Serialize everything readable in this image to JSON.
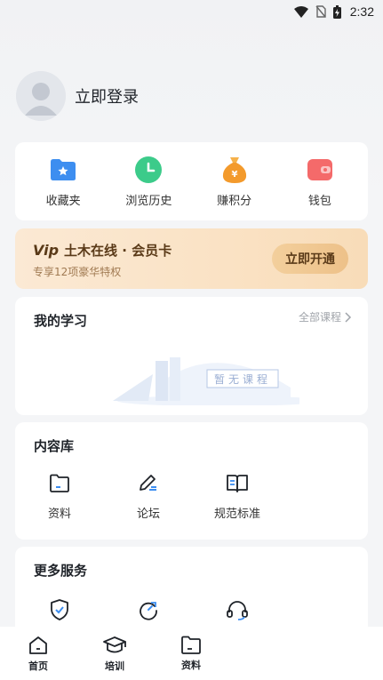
{
  "status_bar": {
    "time": "2:32"
  },
  "profile": {
    "login_label": "立即登录"
  },
  "quick_actions": [
    {
      "label": "收藏夹",
      "icon": "favorites-folder-icon",
      "color": "#3d8ef0"
    },
    {
      "label": "浏览历史",
      "icon": "clock-icon",
      "color": "#3ccb8a"
    },
    {
      "label": "赚积分",
      "icon": "money-bag-icon",
      "color": "#f39a2c"
    },
    {
      "label": "钱包",
      "icon": "wallet-icon",
      "color": "#f46a6a"
    }
  ],
  "vip": {
    "badge": "Vip",
    "title": "土木在线 · 会员卡",
    "subtitle": "专享12项豪华特权",
    "button": "立即开通"
  },
  "study": {
    "title": "我的学习",
    "all_link": "全部课程",
    "empty_text": "暂无课程"
  },
  "library": {
    "title": "内容库",
    "items": [
      {
        "label": "资料",
        "icon": "folder-icon"
      },
      {
        "label": "论坛",
        "icon": "pen-icon"
      },
      {
        "label": "规范标准",
        "icon": "book-icon"
      }
    ]
  },
  "more_services": {
    "title": "更多服务",
    "items": [
      {
        "icon": "shield-check-icon"
      },
      {
        "icon": "refresh-icon"
      },
      {
        "icon": "headset-icon"
      }
    ]
  },
  "tabbar": [
    {
      "label": "首页",
      "icon": "home-icon"
    },
    {
      "label": "培训",
      "icon": "graduation-cap-icon"
    },
    {
      "label": "资料",
      "icon": "folder-icon"
    }
  ]
}
